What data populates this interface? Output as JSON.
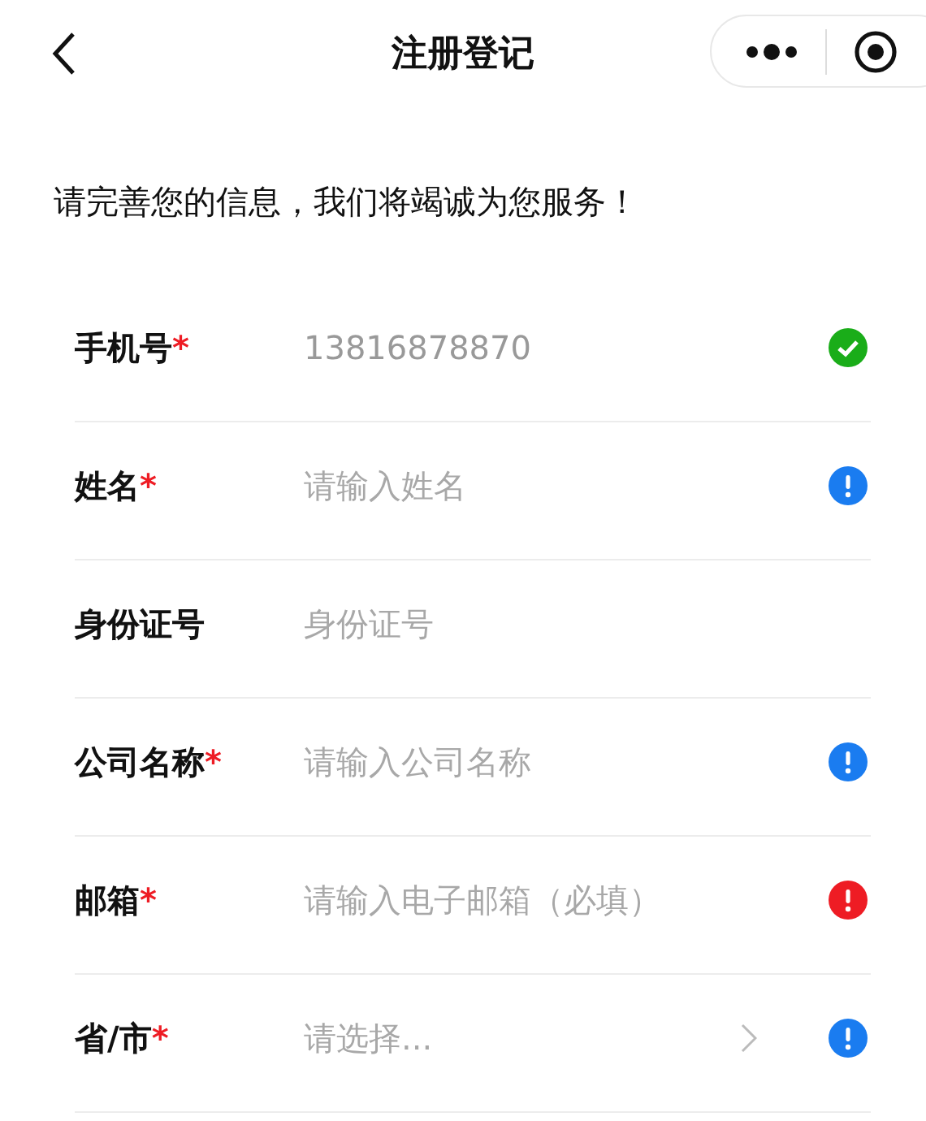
{
  "nav": {
    "title": "注册登记"
  },
  "intro": "请完善您的信息，我们将竭诚为您服务！",
  "fields": [
    {
      "kind": "input",
      "label": "手机号",
      "mark": "*",
      "value": "13816878870",
      "valid": true,
      "color": "#1aad19"
    },
    {
      "kind": "input",
      "label": "姓名",
      "mark": "*",
      "placeholder": "请输入姓名",
      "valid": false,
      "color": "#1a7cf0"
    },
    {
      "kind": "input",
      "label": "身份证号",
      "placeholder": "身份证号"
    },
    {
      "kind": "input",
      "label": "公司名称",
      "mark": "*",
      "placeholder": "请输入公司名称",
      "valid": false,
      "color": "#1a7cf0"
    },
    {
      "kind": "input",
      "label": "邮箱",
      "mark": "*",
      "placeholder": "请输入电子邮箱（必填）",
      "valid": false,
      "color": "#ee1c24"
    },
    {
      "kind": "select",
      "label": "省/市",
      "mark": "*",
      "placeholder": "请选择...",
      "valid": false,
      "color": "#1a7cf0"
    }
  ]
}
